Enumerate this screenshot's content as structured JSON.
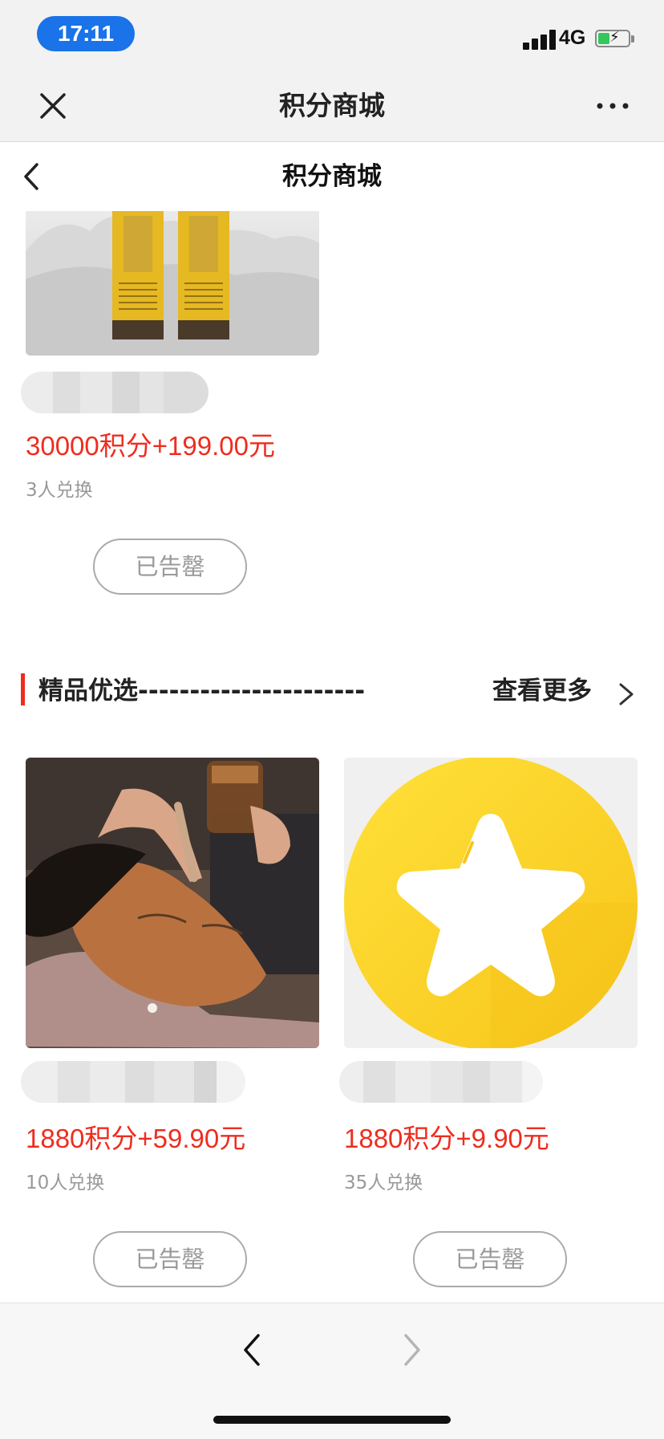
{
  "status_bar": {
    "time": "17:11",
    "network": "4G",
    "battery_color": "#34c759"
  },
  "wechat_nav": {
    "title": "积分商城",
    "close_icon": "close-icon",
    "more_icon": "more-icon"
  },
  "page_header": {
    "title": "积分商城",
    "back_icon": "chevron-left-icon"
  },
  "top_product": {
    "price": "30000积分+199.00元",
    "exchanged": "3人兑换",
    "button": "已告罄"
  },
  "section": {
    "title": "精品优选----------------------",
    "more": "查看更多",
    "chevron_icon": "chevron-right-icon",
    "accent_color": "#ee2d1f"
  },
  "products": [
    {
      "price": "1880积分+59.90元",
      "exchanged": "10人兑换",
      "button": "已告罄"
    },
    {
      "price": "1880积分+9.90元",
      "exchanged": "35人兑换",
      "button": "已告罄"
    }
  ],
  "bottom_bar": {
    "back_icon": "chevron-left-icon",
    "forward_icon": "chevron-right-icon"
  }
}
